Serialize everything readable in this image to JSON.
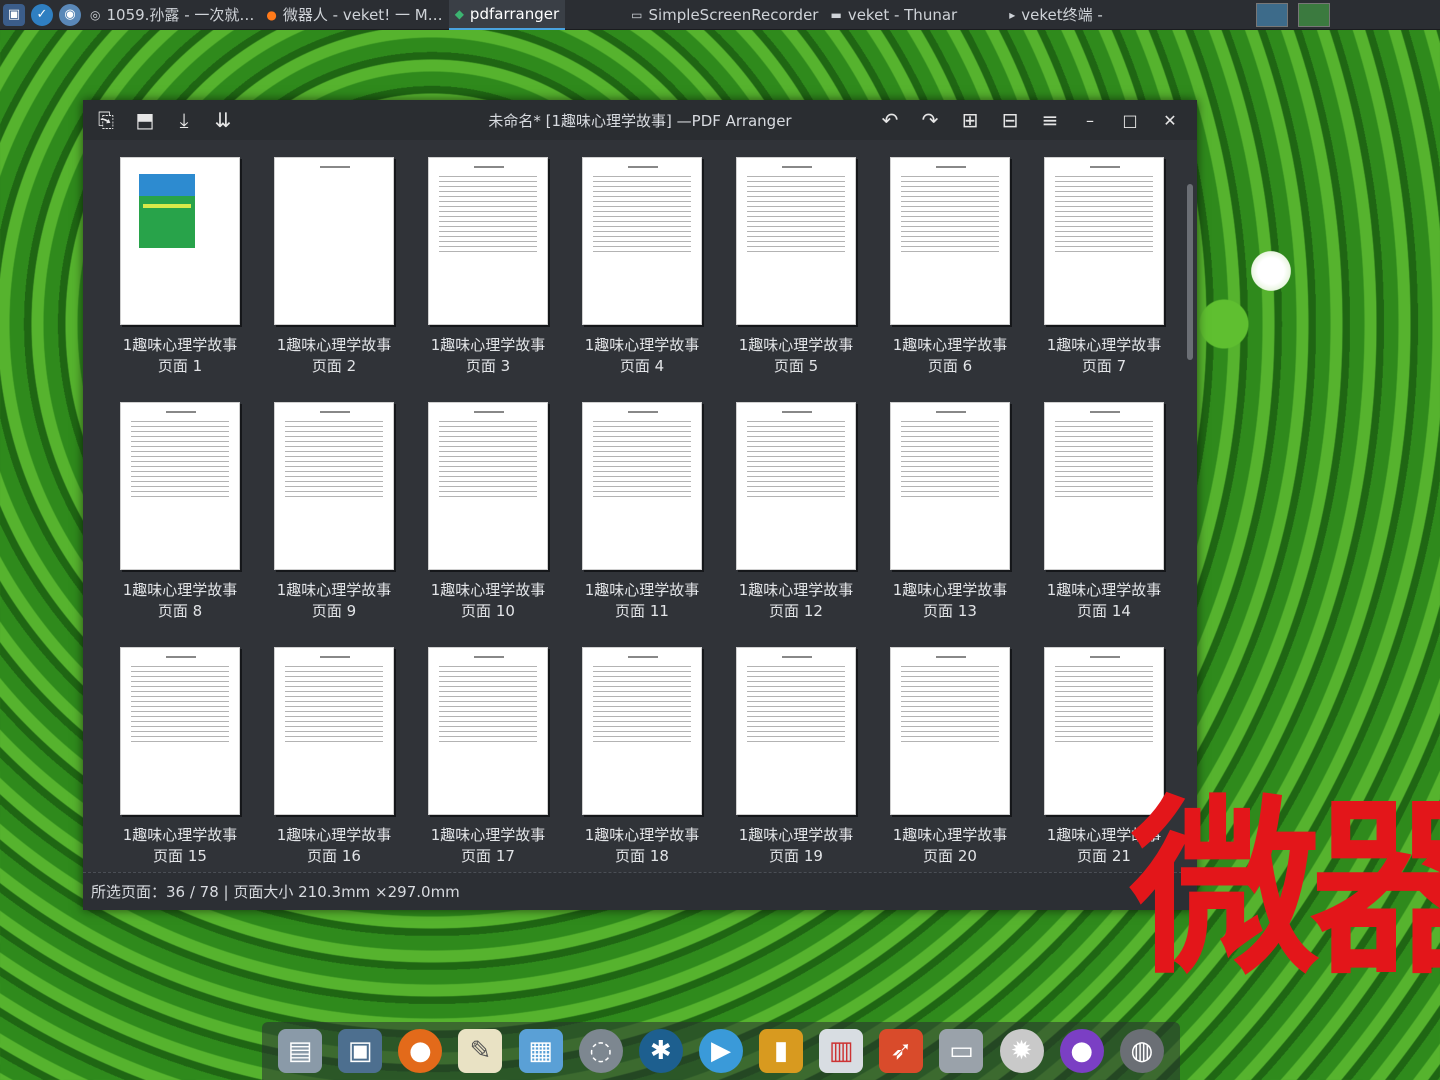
{
  "taskbar": {
    "items": [
      {
        "label": "1059.孙露 - 一次就…",
        "active": false
      },
      {
        "label": "微器人 - veket! 一 M…",
        "active": false
      },
      {
        "label": "pdfarranger",
        "active": true
      },
      {
        "label": "SimpleScreenRecorder",
        "active": false
      },
      {
        "label": "veket - Thunar",
        "active": false
      },
      {
        "label": "veket终端 -",
        "active": false
      }
    ]
  },
  "window": {
    "title": "未命名* [1趣味心理学故事] —PDF Arranger",
    "doc_name": "1趣味心理学故事",
    "page_prefix": "页面",
    "pages": [
      1,
      2,
      3,
      4,
      5,
      6,
      7,
      8,
      9,
      10,
      11,
      12,
      13,
      14,
      15,
      16,
      17,
      18,
      19,
      20,
      21
    ]
  },
  "status": {
    "text": "所选页面：36 / 78 | 页面大小 210.3mm ×297.0mm"
  },
  "overlay": {
    "text": "微器"
  },
  "colors": {
    "accent": "#4aa3df",
    "overlay_red": "#e3161a",
    "window_bg": "#303338"
  }
}
